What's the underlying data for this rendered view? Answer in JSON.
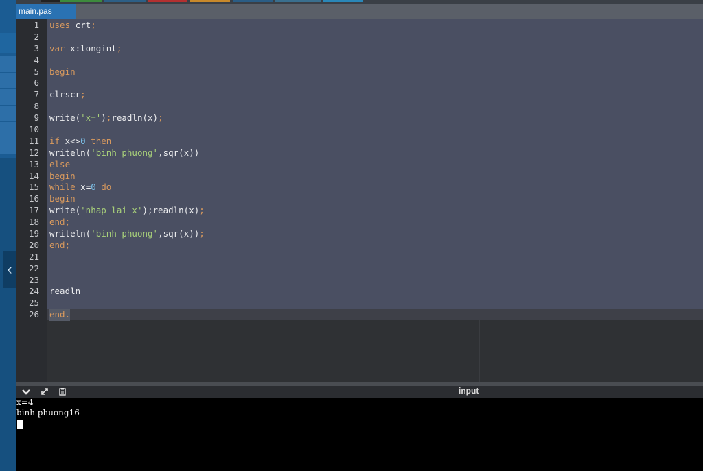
{
  "tab": {
    "filename": "main.pas"
  },
  "code": [
    {
      "n": "1",
      "tokens": [
        [
          "kw",
          "uses"
        ],
        [
          "id",
          " crt"
        ],
        [
          "kw",
          ";"
        ]
      ]
    },
    {
      "n": "2",
      "tokens": []
    },
    {
      "n": "3",
      "tokens": [
        [
          "kw",
          "var"
        ],
        [
          "id",
          " x:longint"
        ],
        [
          "kw",
          ";"
        ]
      ]
    },
    {
      "n": "4",
      "tokens": []
    },
    {
      "n": "5",
      "tokens": [
        [
          "kw",
          "begin"
        ]
      ]
    },
    {
      "n": "6",
      "tokens": []
    },
    {
      "n": "7",
      "tokens": [
        [
          "id",
          "clrscr"
        ],
        [
          "kw",
          ";"
        ]
      ]
    },
    {
      "n": "8",
      "tokens": []
    },
    {
      "n": "9",
      "tokens": [
        [
          "id",
          "write("
        ],
        [
          "str",
          "'x='"
        ],
        [
          "id",
          ")"
        ],
        [
          "kw",
          ";"
        ],
        [
          "id",
          "readln(x)"
        ],
        [
          "kw",
          ";"
        ]
      ]
    },
    {
      "n": "10",
      "tokens": []
    },
    {
      "n": "11",
      "tokens": [
        [
          "kw",
          "if"
        ],
        [
          "id",
          " x<>"
        ],
        [
          "num",
          "0"
        ],
        [
          "kw",
          " then"
        ]
      ]
    },
    {
      "n": "12",
      "tokens": [
        [
          "id",
          "writeln("
        ],
        [
          "str",
          "'binh phuong'"
        ],
        [
          "id",
          ",sqr(x))"
        ]
      ]
    },
    {
      "n": "13",
      "tokens": [
        [
          "kw",
          "else"
        ]
      ]
    },
    {
      "n": "14",
      "tokens": [
        [
          "kw",
          "begin"
        ]
      ]
    },
    {
      "n": "15",
      "tokens": [
        [
          "kw",
          "while"
        ],
        [
          "id",
          " x="
        ],
        [
          "num",
          "0"
        ],
        [
          "kw",
          " do"
        ]
      ]
    },
    {
      "n": "16",
      "tokens": [
        [
          "kw",
          "begin"
        ]
      ]
    },
    {
      "n": "17",
      "tokens": [
        [
          "id",
          "write("
        ],
        [
          "str",
          "'nhap lai x'"
        ],
        [
          "id",
          ");readln(x)"
        ],
        [
          "kw",
          ";"
        ]
      ]
    },
    {
      "n": "18",
      "tokens": [
        [
          "kw",
          "end;"
        ]
      ]
    },
    {
      "n": "19",
      "tokens": [
        [
          "id",
          "writeln("
        ],
        [
          "str",
          "'binh phuong'"
        ],
        [
          "id",
          ",sqr(x))"
        ],
        [
          "kw",
          ";"
        ]
      ]
    },
    {
      "n": "20",
      "tokens": [
        [
          "kw",
          "end;"
        ]
      ]
    },
    {
      "n": "21",
      "tokens": []
    },
    {
      "n": "22",
      "tokens": []
    },
    {
      "n": "23",
      "tokens": []
    },
    {
      "n": "24",
      "tokens": [
        [
          "id",
          "readln"
        ]
      ]
    },
    {
      "n": "25",
      "tokens": []
    },
    {
      "n": "26",
      "tokens": [
        [
          "kw",
          "end."
        ]
      ]
    }
  ],
  "output_panel": {
    "label": "input",
    "buttons": [
      "chevron-down-icon",
      "expand-icon",
      "clipboard-icon"
    ],
    "lines": [
      "x=4",
      "binh phuong16"
    ]
  },
  "colors": {
    "keyword": "#d99a5e",
    "identifier": "#ecedef",
    "string": "#a8d07a",
    "number": "#7cc0e8",
    "tab_active": "#2a72b3",
    "code_bg": "#4a4f62"
  }
}
